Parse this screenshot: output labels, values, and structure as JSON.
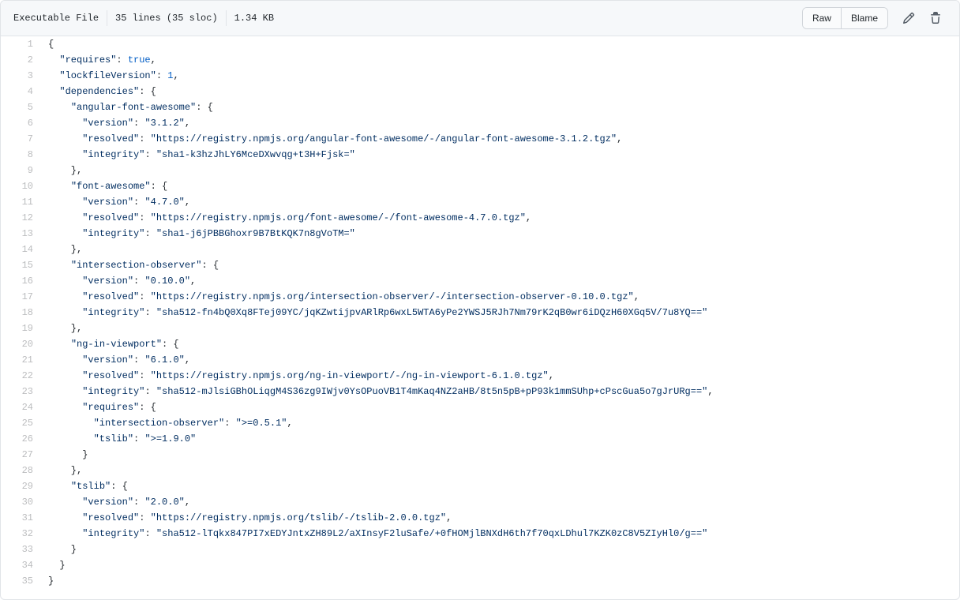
{
  "header": {
    "file_type": "Executable File",
    "lines_info": "35 lines (35 sloc)",
    "size": "1.34 KB",
    "raw_label": "Raw",
    "blame_label": "Blame",
    "edit_icon": "pencil-icon",
    "delete_icon": "trash-icon"
  },
  "code": {
    "lines": [
      {
        "num": "1",
        "text": "{"
      },
      {
        "num": "2",
        "text": "  \"requires\": true,"
      },
      {
        "num": "3",
        "text": "  \"lockfileVersion\": 1,"
      },
      {
        "num": "4",
        "text": "  \"dependencies\": {"
      },
      {
        "num": "5",
        "text": "    \"angular-font-awesome\": {"
      },
      {
        "num": "6",
        "text": "      \"version\": \"3.1.2\","
      },
      {
        "num": "7",
        "text": "      \"resolved\": \"https://registry.npmjs.org/angular-font-awesome/-/angular-font-awesome-3.1.2.tgz\","
      },
      {
        "num": "8",
        "text": "      \"integrity\": \"sha1-k3hzJhLY6MceDXwvqg+t3H+Fjsk=\""
      },
      {
        "num": "9",
        "text": "    },"
      },
      {
        "num": "10",
        "text": "    \"font-awesome\": {"
      },
      {
        "num": "11",
        "text": "      \"version\": \"4.7.0\","
      },
      {
        "num": "12",
        "text": "      \"resolved\": \"https://registry.npmjs.org/font-awesome/-/font-awesome-4.7.0.tgz\","
      },
      {
        "num": "13",
        "text": "      \"integrity\": \"sha1-j6jPBBGhoxr9B7BtKQK7n8gVoTM=\""
      },
      {
        "num": "14",
        "text": "    },"
      },
      {
        "num": "15",
        "text": "    \"intersection-observer\": {"
      },
      {
        "num": "16",
        "text": "      \"version\": \"0.10.0\","
      },
      {
        "num": "17",
        "text": "      \"resolved\": \"https://registry.npmjs.org/intersection-observer/-/intersection-observer-0.10.0.tgz\","
      },
      {
        "num": "18",
        "text": "      \"integrity\": \"sha512-fn4bQ0Xq8FTej09YC/jqKZwtijpvARlRp6wxL5WTA6yPe2YWSJ5RJh7Nm79rK2qB0wr6iDQzH60XGq5V/7u8YQ==\""
      },
      {
        "num": "19",
        "text": "    },"
      },
      {
        "num": "20",
        "text": "    \"ng-in-viewport\": {"
      },
      {
        "num": "21",
        "text": "      \"version\": \"6.1.0\","
      },
      {
        "num": "22",
        "text": "      \"resolved\": \"https://registry.npmjs.org/ng-in-viewport/-/ng-in-viewport-6.1.0.tgz\","
      },
      {
        "num": "23",
        "text": "      \"integrity\": \"sha512-mJlsiGBhOLiqgM4S36zg9IWjv0YsOPuoVB1T4mKaq4NZ2aHB/8t5n5pB+pP93k1mmSUhp+cPscGua5o7gJrURg==\","
      },
      {
        "num": "24",
        "text": "      \"requires\": {"
      },
      {
        "num": "25",
        "text": "        \"intersection-observer\": \">=0.5.1\","
      },
      {
        "num": "26",
        "text": "        \"tslib\": \">=1.9.0\""
      },
      {
        "num": "27",
        "text": "      }"
      },
      {
        "num": "28",
        "text": "    },"
      },
      {
        "num": "29",
        "text": "    \"tslib\": {"
      },
      {
        "num": "30",
        "text": "      \"version\": \"2.0.0\","
      },
      {
        "num": "31",
        "text": "      \"resolved\": \"https://registry.npmjs.org/tslib/-/tslib-2.0.0.tgz\","
      },
      {
        "num": "32",
        "text": "      \"integrity\": \"sha512-lTqkx847PI7xEDYJntxZH89L2/aXInsyF2luSafe/+0fHOMjlBNXdH6th7f70qxLDhul7KZK0zC8V5ZIyHl0/g==\""
      },
      {
        "num": "33",
        "text": "    }"
      },
      {
        "num": "34",
        "text": "  }"
      },
      {
        "num": "35",
        "text": "}"
      }
    ]
  }
}
